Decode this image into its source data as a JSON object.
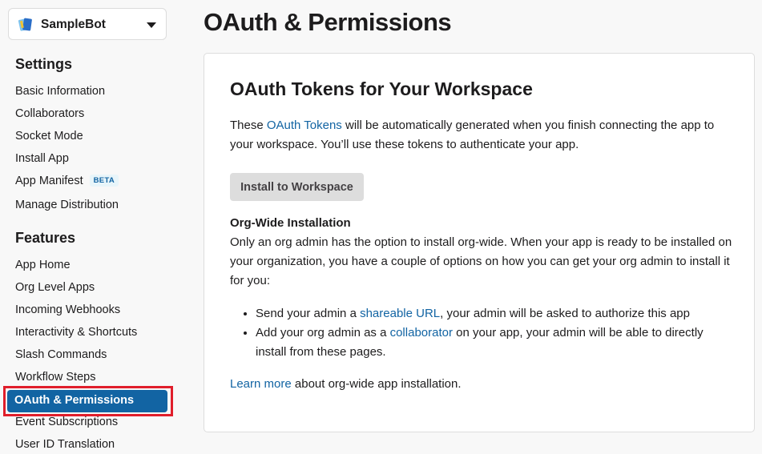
{
  "app_switcher": {
    "name": "SampleBot"
  },
  "sidebar": {
    "settings_title": "Settings",
    "settings_items": [
      {
        "label": "Basic Information"
      },
      {
        "label": "Collaborators"
      },
      {
        "label": "Socket Mode"
      },
      {
        "label": "Install App"
      },
      {
        "label": "App Manifest",
        "badge": "BETA"
      },
      {
        "label": "Manage Distribution"
      }
    ],
    "features_title": "Features",
    "features_items": [
      {
        "label": "App Home"
      },
      {
        "label": "Org Level Apps"
      },
      {
        "label": "Incoming Webhooks"
      },
      {
        "label": "Interactivity & Shortcuts"
      },
      {
        "label": "Slash Commands"
      },
      {
        "label": "Workflow Steps"
      },
      {
        "label": "OAuth & Permissions",
        "active": true
      },
      {
        "label": "Event Subscriptions"
      },
      {
        "label": "User ID Translation"
      }
    ]
  },
  "main": {
    "title": "OAuth & Permissions",
    "card": {
      "heading": "OAuth Tokens for Your Workspace",
      "intro_before": "These ",
      "intro_link": "OAuth Tokens",
      "intro_after": " will be automatically generated when you finish connecting the app to your workspace. You’ll use these tokens to authenticate your app.",
      "install_button": "Install to Workspace",
      "org_heading": "Org-Wide Installation",
      "org_text": "Only an org admin has the option to install org-wide. When your app is ready to be installed on your organization, you have a couple of options on how you can get your org admin to install it for you:",
      "bullet1_before": "Send your admin a ",
      "bullet1_link": "shareable URL",
      "bullet1_after": ", your admin will be asked to authorize this app",
      "bullet2_before": "Add your org admin as a ",
      "bullet2_link": "collaborator",
      "bullet2_after": " on your app, your admin will be able to directly install from these pages.",
      "learn_link": "Learn more",
      "learn_after": " about org-wide app installation."
    }
  },
  "colors": {
    "link": "#1264a3",
    "active_nav": "#1264a3",
    "highlight": "#e01e2b"
  }
}
